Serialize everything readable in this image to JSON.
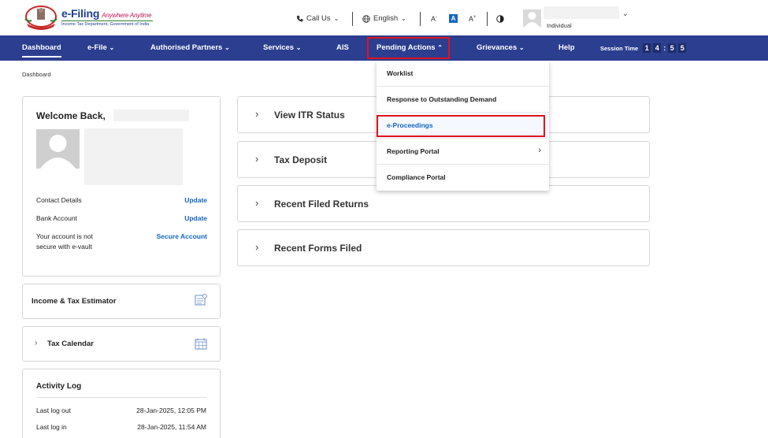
{
  "header": {
    "brand_title": "e-Filing",
    "brand_tagline": "Anywhere Anytime",
    "brand_subtitle": "Income Tax Department, Government of India",
    "call_us": "Call Us",
    "language": "English",
    "font_small": "A",
    "font_normal": "A",
    "font_large": "A",
    "contrast_icon": "contrast-icon",
    "user_role": "Individual"
  },
  "nav": {
    "items": [
      {
        "label": "Dashboard"
      },
      {
        "label": "e-File"
      },
      {
        "label": "Authorised Partners"
      },
      {
        "label": "Services"
      },
      {
        "label": "AIS"
      },
      {
        "label": "Pending Actions"
      },
      {
        "label": "Grievances"
      },
      {
        "label": "Help"
      }
    ],
    "session_label": "Session Time",
    "session_digits": [
      "1",
      "4",
      "5",
      "5"
    ]
  },
  "breadcrumb": "Dashboard",
  "profile": {
    "welcome": "Welcome Back,",
    "contact_label": "Contact Details",
    "contact_link": "Update",
    "bank_label": "Bank Account",
    "bank_link": "Update",
    "secure_label_1": "Your account is not",
    "secure_label_2": "secure with e-vault",
    "secure_link": "Secure Account"
  },
  "side_cards": {
    "estimator": "Income & Tax Estimator",
    "calendar": "Tax Calendar"
  },
  "activity": {
    "title": "Activity Log",
    "rows": [
      {
        "label": "Last log out",
        "value": "28-Jan-2025, 12:05 PM"
      },
      {
        "label": "Last log in",
        "value": "28-Jan-2025, 11:54 AM"
      }
    ]
  },
  "accordion": [
    {
      "title": "View ITR Status"
    },
    {
      "title": "Tax Deposit"
    },
    {
      "title": "Recent Filed Returns"
    },
    {
      "title": "Recent Forms Filed"
    }
  ],
  "pending_menu": {
    "items": [
      {
        "label": "Worklist"
      },
      {
        "label": "Response to Outstanding Demand"
      },
      {
        "label": "e-Proceedings"
      },
      {
        "label": "Reporting Portal"
      },
      {
        "label": "Compliance Portal"
      }
    ]
  },
  "colors": {
    "nav_bg": "#2c3e8f",
    "link": "#1565c0",
    "highlight": "#e0141e"
  }
}
